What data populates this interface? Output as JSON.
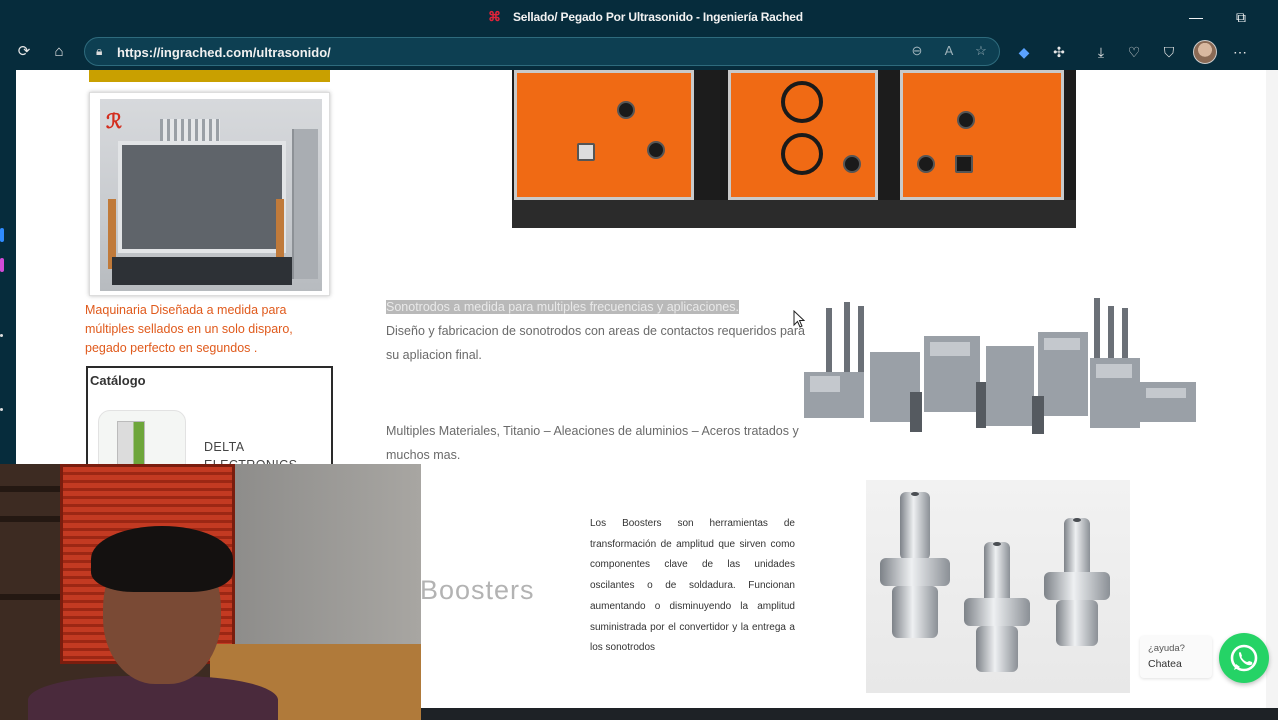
{
  "browser": {
    "window_title": "Sellado/ Pegado Por Ultrasonido - Ingeniería Rached",
    "url": "https://ingrached.com/ultrasonido/",
    "controls": {
      "minimize": "—",
      "restore": "⧉"
    }
  },
  "left_column": {
    "machine_caption": "Maquinaria Diseñada a medida para múltiples sellados en un solo disparo, pegado perfecto en segundos .",
    "catalog": {
      "title": "Catálogo",
      "brand_line1": "DELTA",
      "brand_line2": "ELECTRONICS"
    }
  },
  "sonotrodes": {
    "heading": "Sonotrodos a medida para multiples frecuencias y aplicaciones.",
    "description": "Diseño y fabricacion de sonotrodos con areas de contactos requeridos para su apliacion final.",
    "materials": "Multiples Materiales, Titanio – Aleaciones de aluminios – Aceros tratados y muchos mas."
  },
  "boosters": {
    "heading": "Boosters",
    "description": "Los Boosters son herramientas de transformación de amplitud que sirven como componentes clave de las unidades oscilantes o de soldadura. Funcionan aumentando o disminuyendo la amplitud suministrada por el convertidor y la entrega a los sonotrodos"
  },
  "chat_widget": {
    "question": "¿ayuda?",
    "action": "Chatea"
  },
  "colors": {
    "chrome": "#062c3c",
    "caption_orange": "#e05a1c",
    "generator_orange": "#f06a14",
    "whatsapp_green": "#25d366"
  },
  "icons": [
    "refresh-icon",
    "home-icon",
    "lock-icon",
    "zoom-out-icon",
    "read-aloud-icon",
    "favorite-star-icon",
    "shield-extension-icon",
    "extensions-icon",
    "downloads-icon",
    "health-icon",
    "browser-essentials-icon",
    "more-menu-icon",
    "whatsapp-icon",
    "mouse-cursor-icon"
  ]
}
